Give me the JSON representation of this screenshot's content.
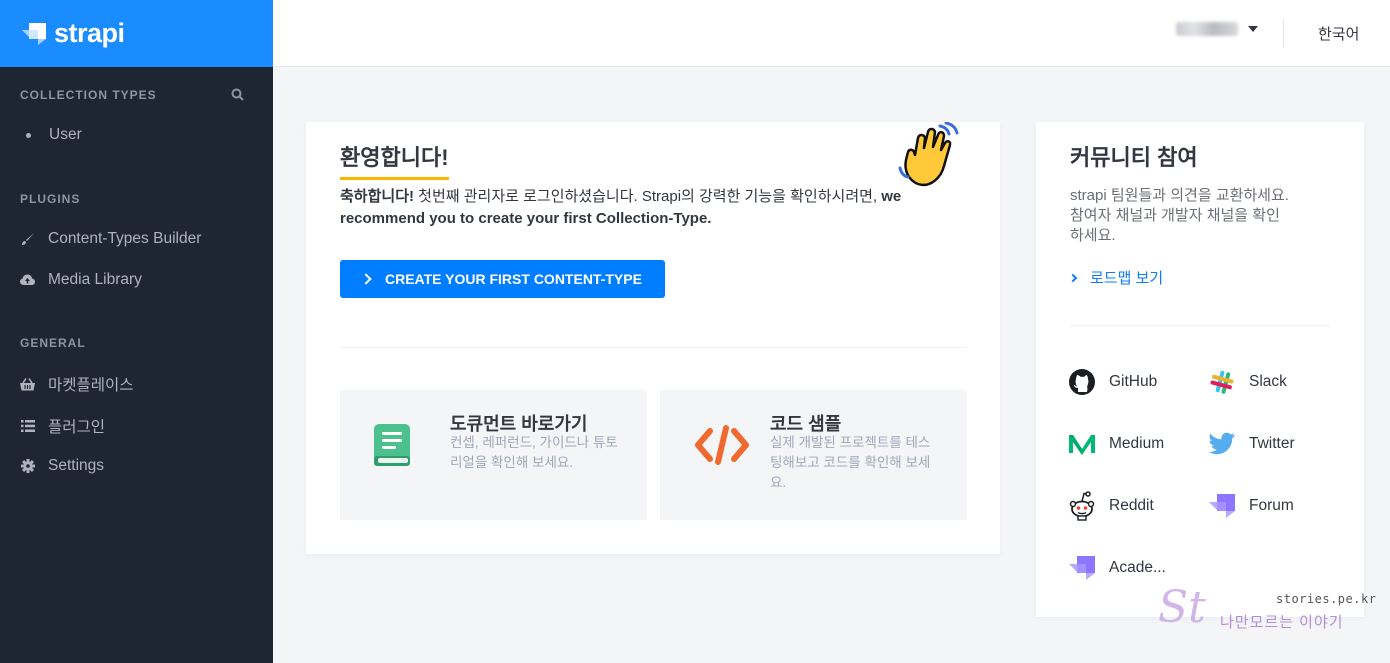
{
  "brand": {
    "name": "strapi"
  },
  "sidebar": {
    "sections": [
      {
        "title": "COLLECTION TYPES",
        "items": [
          {
            "label": "User",
            "icon": "bullet-icon"
          }
        ]
      },
      {
        "title": "PLUGINS",
        "items": [
          {
            "label": "Content-Types Builder",
            "icon": "brush-icon"
          },
          {
            "label": "Media Library",
            "icon": "cloud-upload-icon"
          }
        ]
      },
      {
        "title": "GENERAL",
        "items": [
          {
            "label": "마켓플레이스",
            "icon": "basket-icon"
          },
          {
            "label": "플러그인",
            "icon": "list-icon"
          },
          {
            "label": "Settings",
            "icon": "gear-icon"
          }
        ]
      }
    ]
  },
  "header": {
    "language": "한국어"
  },
  "welcome": {
    "title": "환영합니다!",
    "desc_bold": "축하합니다!",
    "desc_rest": " 첫번째 관리자로 로그인하셨습니다. Strapi의 강력한 기능을 확인하시려면, ",
    "desc_bold2": "we recommend you to create your first Collection-Type.",
    "cta_label": "CREATE YOUR FIRST CONTENT-TYPE",
    "tiles": [
      {
        "title": "도큐먼트 바로가기",
        "desc": "컨셉, 레퍼런드, 가이드나 튜토리얼을 확인해 보세요."
      },
      {
        "title": "코드 샘플",
        "desc": "실제 개발된 프로젝트를 테스팅해보고 코드를 확인해 보세요."
      }
    ]
  },
  "community": {
    "title": "커뮤니티 참여",
    "desc": "strapi 팀원들과 의견을 교환하세요. 참여자 채널과 개발자 채널을 확인하세요.",
    "roadmap": "로드맵 보기",
    "links": [
      "GitHub",
      "Slack",
      "Medium",
      "Twitter",
      "Reddit",
      "Forum",
      "Acade..."
    ]
  },
  "watermark": {
    "site": "stories.pe.kr",
    "tagline": "나만모르는 이야기",
    "logo": "St"
  },
  "colors": {
    "brand": "#1a8cff",
    "sidebar": "#1e2634",
    "primary": "#007eff",
    "accent_underline": "#ffb500"
  }
}
